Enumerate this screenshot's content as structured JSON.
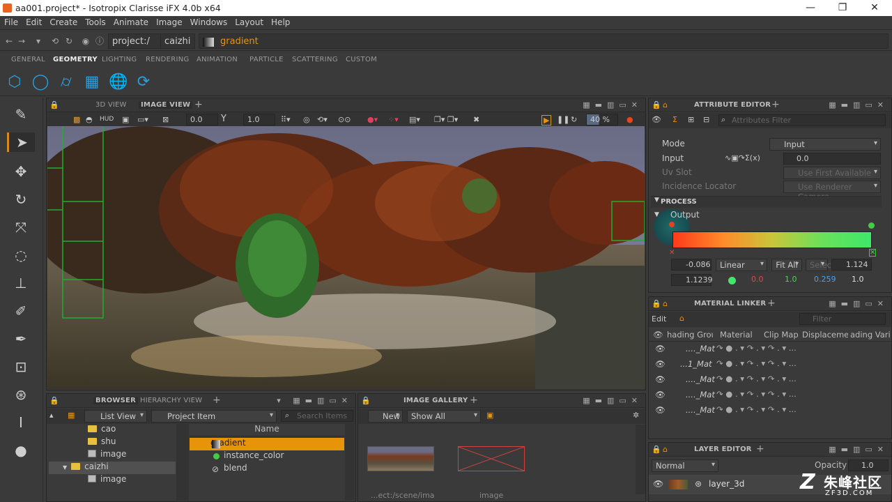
{
  "window": {
    "title": "aa001.project* - Isotropix Clarisse iFX 4.0b x64"
  },
  "menu": [
    "File",
    "Edit",
    "Create",
    "Tools",
    "Animate",
    "Image",
    "Windows",
    "Layout",
    "Help"
  ],
  "address": {
    "crumbs": [
      "project:/",
      "caizhi"
    ],
    "current": "gradient"
  },
  "tabs": [
    "GENERAL",
    "GEOMETRY",
    "LIGHTING",
    "RENDERING",
    "ANIMATION",
    "PARTICLE",
    "SCATTERING",
    "CUSTOM"
  ],
  "active_tab": "GEOMETRY",
  "shelf_icons": [
    "cube-icon",
    "sphere-icon",
    "cylinder-icon",
    "grid-icon",
    "globe-icon",
    "volume-icon"
  ],
  "tools": [
    "eyedropper-icon",
    "select-arrow-icon",
    "move-icon",
    "rotate-icon",
    "scale-icon",
    "orbit-icon",
    "stamp-icon",
    "paint-icon",
    "brush-icon",
    "frame-icon",
    "camera-icon",
    "ruler-icon",
    "shading-icon"
  ],
  "viewport": {
    "tabs": [
      "3D VIEW",
      "IMAGE VIEW"
    ],
    "active": "IMAGE VIEW",
    "hud": "HUD",
    "exposure": "0.0",
    "gamma_label": "Y",
    "gamma": "1.0",
    "zoom": "40 %"
  },
  "attribute_editor": {
    "title": "ATTRIBUTE EDITOR",
    "filter_placeholder": "Attributes Filter",
    "rows": [
      {
        "label": "Mode",
        "value": "Input"
      },
      {
        "label": "Input",
        "value": "0.0"
      },
      {
        "label": "Uv Slot",
        "value": "Use First Available"
      },
      {
        "label": "Incidence Locator",
        "value": "Use Renderer Camera"
      }
    ],
    "section": "PROCESS",
    "output_label": "Output",
    "gradient": {
      "pos": "-0.086",
      "interp": "Linear",
      "fit": "Fit All",
      "select": "Selec",
      "scale": "1.124",
      "key_pos": "1.1239",
      "r": "0.0",
      "g": "1.0",
      "b": "0.259",
      "a": "1.0"
    }
  },
  "material_linker": {
    "title": "MATERIAL LINKER",
    "edit": "Edit",
    "filter_placeholder": "Filter",
    "columns": [
      "hading Grou",
      "Material",
      "Clip Map",
      "Displacemen",
      "ading Varial"
    ],
    "rows": [
      "...._Mat",
      "...1_Mat",
      "...._Mat",
      "...._Mat",
      "...._Mat"
    ]
  },
  "layer_editor": {
    "title": "LAYER EDITOR",
    "blend": "Normal",
    "opacity_label": "Opacity",
    "opacity": "1.0",
    "layer": "layer_3d"
  },
  "browser": {
    "tabs": [
      "BROWSER",
      "HIERARCHY VIEW"
    ],
    "view_mode": "List View",
    "filter": "Project Item",
    "search_placeholder": "Search Items",
    "tree": [
      {
        "type": "folder",
        "name": "cao",
        "indent": 1
      },
      {
        "type": "folder",
        "name": "shu",
        "indent": 1
      },
      {
        "type": "image",
        "name": "image",
        "indent": 1
      },
      {
        "type": "folder",
        "name": "caizhi",
        "indent": 0,
        "selected": true
      },
      {
        "type": "image",
        "name": "image",
        "indent": 1
      }
    ],
    "column_header": "Name",
    "items": [
      {
        "name": "gradient",
        "selected": true,
        "icon": "gradient-icon"
      },
      {
        "name": "instance_color",
        "selected": false,
        "icon": "instance-color-icon"
      },
      {
        "name": "blend",
        "selected": false,
        "icon": "blend-icon"
      }
    ]
  },
  "image_gallery": {
    "title": "IMAGE GALLERY",
    "new_label": "New",
    "show": "Show All",
    "thumbs": [
      {
        "label": "...ect:/scene/image"
      },
      {
        "label": "image"
      }
    ]
  },
  "watermark": {
    "text": "朱峰社区",
    "sub": "ZF3D.COM"
  }
}
